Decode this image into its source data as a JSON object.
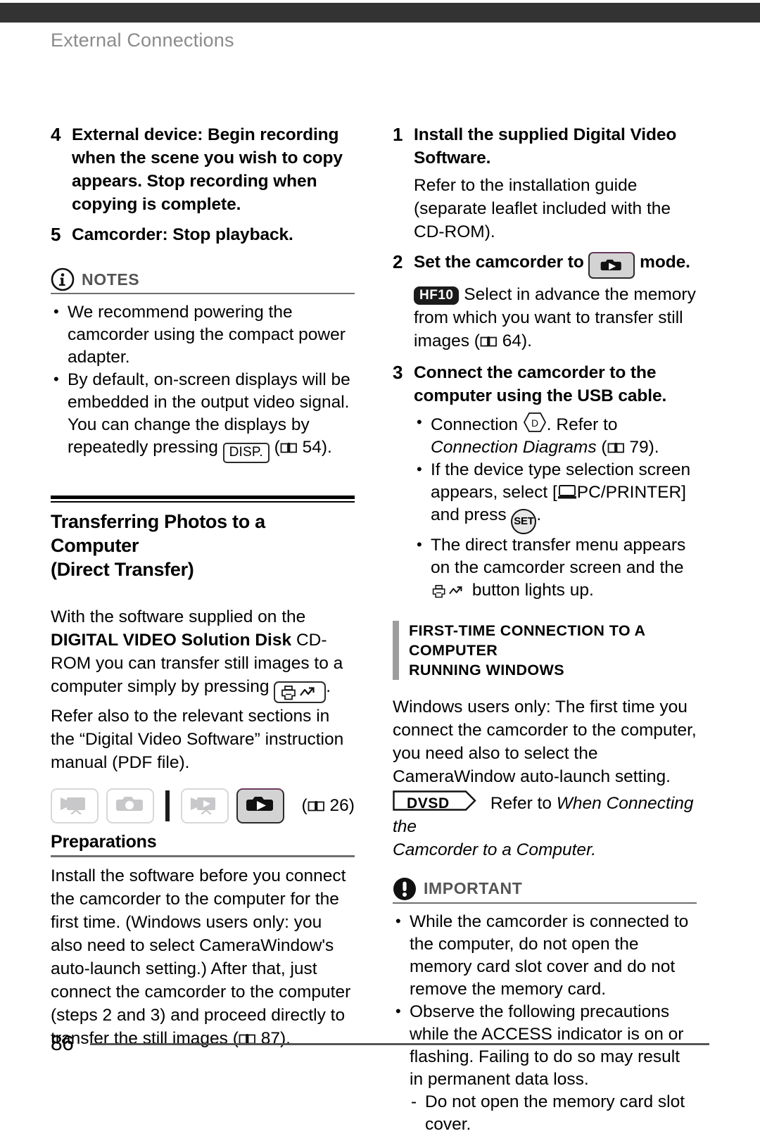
{
  "header": {
    "running_head": "External Connections"
  },
  "footer": {
    "page_number": "86"
  },
  "left_column": {
    "steps": [
      {
        "number": "4",
        "title": "External device: Begin recording when the scene you wish to copy appears. Stop recording when copying is complete."
      },
      {
        "number": "5",
        "title": "Camcorder: Stop playback."
      }
    ],
    "notes": {
      "icon": "info-circle-icon",
      "title": "NOTES",
      "bullets": [
        {
          "pre": "We recommend powering the camcorder using the compact power adapter.",
          "post": ""
        },
        {
          "pre": "By default, on-screen displays will be embedded in the output video signal. You can change the displays by repeatedly pressing",
          "chip": "DISP.",
          "post": "54)."
        }
      ]
    },
    "section": {
      "heading_line1": "Transferring Photos to a Computer",
      "heading_line2": "(Direct Transfer)",
      "intro_a": "With the software supplied on the",
      "intro_b_bold": "DIGITAL VIDEO Solution Disk",
      "intro_c": "CD-ROM you can transfer still images to a computer simply by pressing",
      "intro_d": ".",
      "intro_e": "Refer also to the relevant sections in the “Digital Video Software” instruction manual (PDF file).",
      "mode_row": {
        "buttons": [
          {
            "name": "movie-record-mode",
            "state": "inactive",
            "icon": "camcorder-record-icon"
          },
          {
            "name": "photo-record-mode",
            "state": "inactive",
            "icon": "camera-record-icon"
          },
          {
            "name": "movie-playback-mode",
            "state": "inactive",
            "icon": "camcorder-playback-icon"
          },
          {
            "name": "photo-playback-mode",
            "state": "active",
            "icon": "camera-playback-icon"
          }
        ],
        "page_ref": "26"
      },
      "sub_heading": "Preparations",
      "prep_text": "Install the software before you connect the camcorder to the computer for the first time. (Windows users only: you also need to select CameraWindow's auto-launch setting.) After that, just connect the camcorder to the computer (steps 2 and 3) and proceed directly to transfer the still images (",
      "prep_page_ref": "87).",
      "page_ref_54": "54)."
    }
  },
  "right_column": {
    "steps": [
      {
        "number": "1",
        "title": "Install the supplied Digital Video Software.",
        "body": "Refer to the installation guide (separate leaflet included with the CD-ROM)."
      },
      {
        "number": "2",
        "title_a": "Set the camcorder to",
        "title_b": "mode.",
        "badge": "HF10",
        "body": "Select in advance the memory from which you want to transfer still images (",
        "page_ref": "64)."
      },
      {
        "number": "3",
        "title": "Connect the camcorder to the computer using the USB cable.",
        "bullets": [
          {
            "pre": "Connection",
            "hex_label": "D",
            "mid": ". Refer to",
            "italic": "Connection Diagrams",
            "page_ref": "79)."
          },
          {
            "pre": "If the device type selection screen appears, select [",
            "mid": "PC/PRINTER] and press",
            "set_label": "SET",
            "post": "."
          },
          {
            "pre": "The direct transfer menu appears on the camcorder screen and the",
            "post": "button lights up."
          }
        ]
      }
    ],
    "bar_callout": {
      "title_line1": "First-time connection to a computer",
      "title_line2": "running Windows",
      "body": "Windows users only: The first time you connect the camcorder to the computer, you need also to select the CameraWindow auto-launch setting.",
      "dvsd_badge": "DVSD",
      "dvsd_text_plain": "Refer to",
      "dvsd_text_italic_1": "When Connecting the",
      "dvsd_text_italic_2": "Camcorder to a Computer."
    },
    "important": {
      "icon": "exclamation-circle-icon",
      "title": "IMPORTANT",
      "bullets": [
        {
          "text": "While the camcorder is connected to the computer, do not open the memory card slot cover and do not remove the memory card.",
          "sub": []
        },
        {
          "text": "Observe the following precautions while the ACCESS indicator is on or flashing. Failing to do so may result in permanent data loss.",
          "sub": [
            "Do not open the memory card slot cover."
          ]
        }
      ]
    }
  },
  "colors": {
    "topbar": "#333333",
    "running_head": "#8b8b8b",
    "callout_title": "#555555",
    "active_mode_bg": "#d3d3d3",
    "active_mode_accent": "#6b3a5e"
  }
}
